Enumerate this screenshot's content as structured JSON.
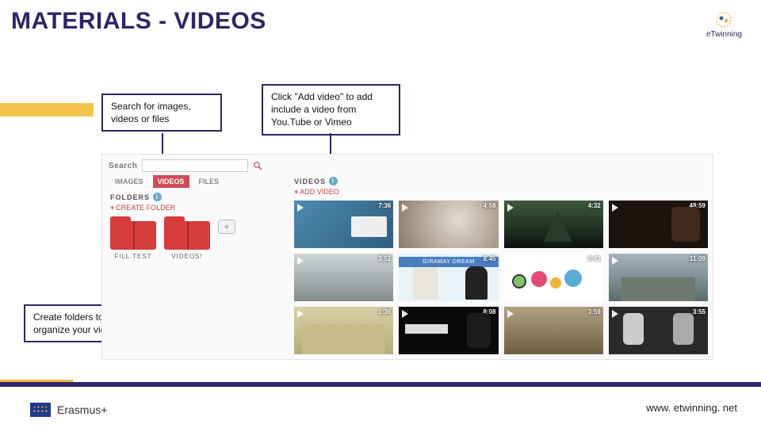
{
  "title": "MATERIALS - VIDEOS",
  "logo": {
    "name": "eTwinning"
  },
  "callouts": {
    "search": "Search for images, videos or files",
    "add_video": "Click \"Add video\" to add include a video from You.Tube or Vimeo",
    "folders": "Create folders to organize your videos"
  },
  "panel": {
    "search_label": "Search",
    "search_value": "",
    "tabs": {
      "images": "IMAGES",
      "videos": "VIDEOS",
      "files": "FILES"
    },
    "folders_header": "FOLDERS",
    "create_folder": "CREATE FOLDER",
    "folder_items": [
      "FILL TEST",
      "VIDEOS!"
    ],
    "videos_header": "VIDEOS",
    "add_video": "ADD VIDEO",
    "grid_banner": "GIRAWAY DREAM",
    "durations": [
      "7:36",
      "4:58",
      "4:32",
      "48:59",
      "3:51",
      "8:45",
      "0:41",
      "11:09",
      "1:36",
      "8:08",
      "3:59",
      "3:55"
    ]
  },
  "footer": {
    "program": "Erasmus+",
    "url": "www. etwinning. net"
  }
}
